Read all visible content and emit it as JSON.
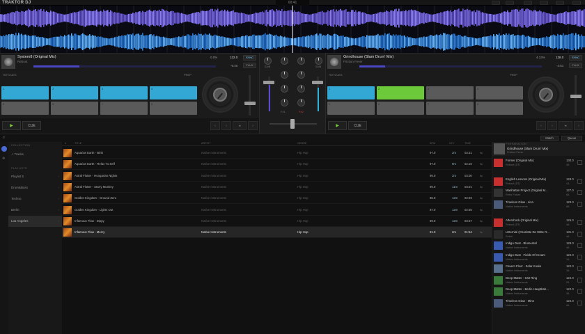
{
  "app": {
    "title": "TRAKTOR DJ",
    "clock": "00:41"
  },
  "deck_a": {
    "title": "System8 (Original Mix)",
    "artist": "Reboot",
    "bpm_label": "0.0%",
    "bpm": "132.0",
    "sync": "SYNC",
    "flux": "FLUX",
    "time_remaining": "-6:40",
    "hotcues_label": "HOTCUES",
    "section_label": "PREP",
    "progress": 0.25,
    "pads": [
      {
        "n": "1",
        "color": "#34a8d4"
      },
      {
        "n": "2",
        "color": "#34a8d4"
      },
      {
        "n": "3",
        "color": "#34a8d4"
      },
      {
        "n": "4",
        "color": "#34a8d4"
      },
      {
        "n": "5",
        "color": "#5a5a5a"
      },
      {
        "n": "6",
        "color": "#5a5a5a"
      },
      {
        "n": "7",
        "color": "#5a5a5a"
      },
      {
        "n": "8",
        "color": "#5a5a5a"
      }
    ],
    "play": "▶",
    "cue": "CUE"
  },
  "deck_b": {
    "title": "Grindhouse (Slam Drum' Mix)",
    "artist": "Friction Fever",
    "bpm_label": "4.13%",
    "bpm": "128.0",
    "sync": "SYNC",
    "flux": "FLUX",
    "time_remaining": "-4:51",
    "hotcues_label": "HOTCUES",
    "section_label": "PREP",
    "progress": 0.14,
    "pads": [
      {
        "n": "1",
        "color": "#34a8d4"
      },
      {
        "n": "2",
        "color": "#6cc93a"
      },
      {
        "n": "3",
        "color": "#5a5a5a"
      },
      {
        "n": "4",
        "color": "#5a5a5a"
      },
      {
        "n": "5",
        "color": "#5a5a5a"
      },
      {
        "n": "6",
        "color": "#5a5a5a"
      },
      {
        "n": "7",
        "color": "#5a5a5a"
      },
      {
        "n": "8",
        "color": "#5a5a5a"
      }
    ],
    "play": "▶",
    "cue": "CUE"
  },
  "mixer": {
    "gain_a": "GAIN",
    "gain_b": "GAIN",
    "fx_a": "FX1",
    "fx_b": "FX2"
  },
  "browser": {
    "match": "Match",
    "queue": "Queue",
    "search_placeholder": "",
    "sidebar_head_collection": "COLLECTION",
    "sidebar_tracks": "Tracks",
    "sidebar_head_playlists": "PLAYLISTS",
    "playlists": [
      "Playlist 5",
      "Drum&Bass",
      "Techno",
      "Berlin",
      "Los Angeles"
    ],
    "columns": {
      "num": "#",
      "title": "TITLE",
      "artist": "ARTIST",
      "genre": "GENRE",
      "bpm": "BPM",
      "key": "KEY",
      "time": "TIME"
    },
    "tracks": [
      {
        "title": "Aquarius Earth - Birth",
        "artist": "Native Instruments",
        "genre": "Hip Hop",
        "bpm": "97.0",
        "key": "2m",
        "time": "03:31"
      },
      {
        "title": "Aquarius Earth - Relax Yo Self",
        "artist": "Native Instruments",
        "genre": "Hip Hop",
        "bpm": "97.0",
        "key": "9m",
        "time": "02:16"
      },
      {
        "title": "Astral Flutter - Hungarian Nights",
        "artist": "Native Instruments",
        "genre": "Hip Hop",
        "bpm": "95.0",
        "key": "2m",
        "time": "03:00"
      },
      {
        "title": "Astral Flutter - Starry Monkey",
        "artist": "Native Instruments",
        "genre": "Hip Hop",
        "bpm": "95.0",
        "key": "11m",
        "time": "03:01"
      },
      {
        "title": "Golden Kingdom - Ground Zero",
        "artist": "Native Instruments",
        "genre": "Hip Hop",
        "bpm": "85.0",
        "key": "12m",
        "time": "02:29"
      },
      {
        "title": "Golden Kingdom - Lights Out",
        "artist": "Native Instruments",
        "genre": "Hip Hop",
        "bpm": "87.0",
        "key": "12m",
        "time": "02:55"
      },
      {
        "title": "Infamous Flow - Dippy",
        "artist": "Native Instruments",
        "genre": "Hip Hop",
        "bpm": "89.0",
        "key": "12m",
        "time": "03:27"
      },
      {
        "title": "Infamous Flow - Mercy",
        "artist": "Native Instruments",
        "genre": "Hip Hop",
        "bpm": "91.0",
        "key": "2m",
        "time": "01:54"
      }
    ],
    "queue_header": "PREPARATION",
    "queue_now": {
      "title": "Grindhouse (Slam Drum' Mix)",
      "artist": "Friction Fever"
    },
    "queue_items": [
      {
        "title": "Former (Original Mix)",
        "artist": "Reboot (DT)",
        "bpm": "130.0",
        "key": "4A",
        "art": "#c83030"
      },
      {
        "title": "English Lessons (Original Mix)",
        "artist": "Reboot (DT)",
        "bpm": "128.0",
        "key": "1A",
        "art": "#c83030"
      },
      {
        "title": "Manhattan Project (Original M...",
        "artist": "Retro Future",
        "bpm": "127.0",
        "key": "8A",
        "art": "#333333"
      },
      {
        "title": "Timeless Glow - Liza",
        "artist": "Native Instruments",
        "bpm": "123.0",
        "key": "8A",
        "art": "#4a5a78"
      },
      {
        "title": "Aftershock (Original Mix)",
        "artist": "Reboot (DT)",
        "bpm": "126.0",
        "key": "4A",
        "art": "#c83030"
      },
      {
        "title": "LEternité (Charlotte De Witte R...",
        "artist": "Rebel",
        "bpm": "131.0",
        "key": "4A",
        "art": "#2a2a2a"
      },
      {
        "title": "Indigo Dust - Blumental",
        "artist": "Native Instruments",
        "bpm": "129.0",
        "key": "4A",
        "art": "#3a5ab0"
      },
      {
        "title": "Indigo Dust - Fields Of Cream",
        "artist": "Native Instruments",
        "bpm": "122.0",
        "key": "1A",
        "art": "#3a5ab0"
      },
      {
        "title": "Cavern Floor - Solar Koala",
        "artist": "Native Instruments",
        "bpm": "122.0",
        "key": "3A",
        "art": "#58708c"
      },
      {
        "title": "Deep Matter - S42 Ring",
        "artist": "Native Instruments",
        "bpm": "124.0",
        "key": "2A",
        "art": "#3a7a3a"
      },
      {
        "title": "Deep Matter - Berlin Hauptbah...",
        "artist": "Native Instruments",
        "bpm": "122.0",
        "key": "4A",
        "art": "#3a7a3a"
      },
      {
        "title": "Timeless Glow - Mine",
        "artist": "Native Instruments",
        "bpm": "122.0",
        "key": "4A",
        "art": "#4a5a78"
      }
    ]
  }
}
